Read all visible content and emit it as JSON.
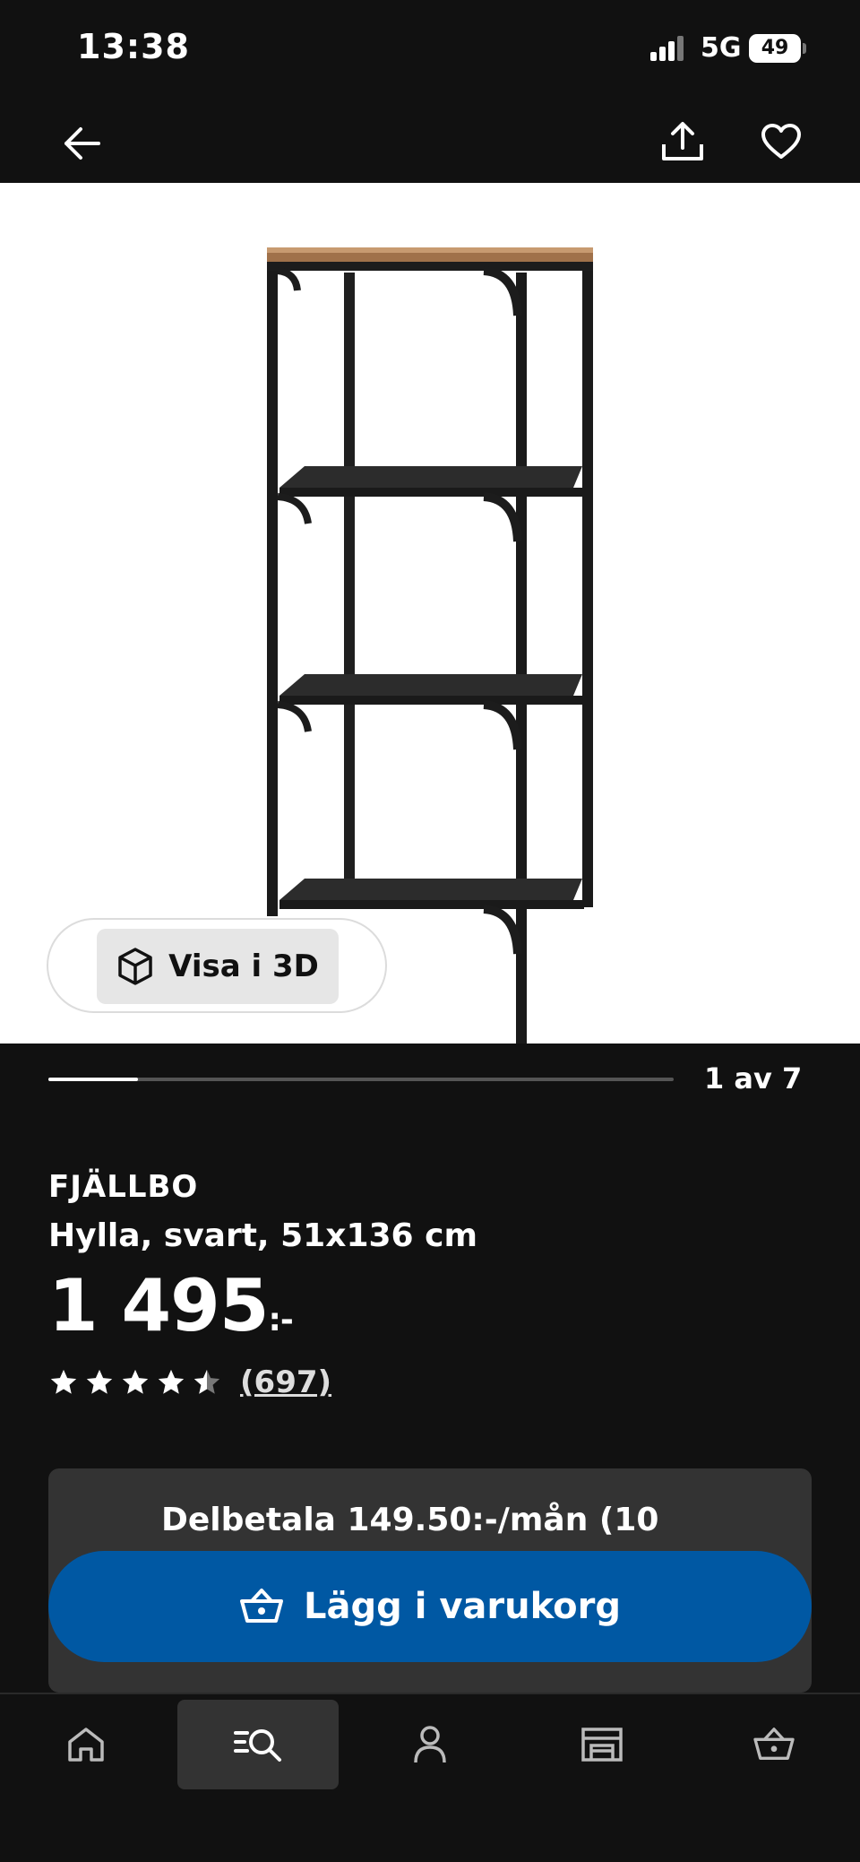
{
  "status_bar": {
    "time": "13:38",
    "network": "5G",
    "battery": "49"
  },
  "carousel": {
    "page_indicator": "1 av 7",
    "current": 1,
    "total": 7
  },
  "view_3d": {
    "label": "Visa i 3D"
  },
  "product": {
    "brand": "FJÄLLBO",
    "description": "Hylla, svart, 51x136 cm",
    "price": "1 495",
    "price_suffix": ":-",
    "rating": 4.5,
    "review_count": "(697)"
  },
  "installment": {
    "text": "Delbetala 149.50:-/mån (10 mån, ... Bank"
  },
  "add_to_cart": {
    "label": "Lägg i varukorg"
  },
  "bottom_nav": [
    "home",
    "search",
    "profile",
    "store",
    "cart"
  ],
  "colors": {
    "background": "#111111",
    "accent": "#0058a3",
    "surface": "#333333"
  }
}
